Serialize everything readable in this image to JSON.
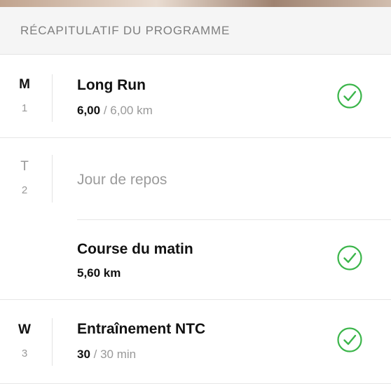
{
  "header": {
    "title": "RÉCAPITULATIF DU PROGRAMME"
  },
  "accent_color": "#3bb54a",
  "days": [
    {
      "letter": "M",
      "number": "1",
      "activities": [
        {
          "title": "Long Run",
          "done": "6,00",
          "separator": " / ",
          "goal": "6,00 km",
          "completed": true,
          "icon": "check-circle-icon"
        }
      ]
    },
    {
      "letter": "T",
      "number": "2",
      "rest_label": "Jour de repos",
      "activities": [
        {
          "title": "Course du matin",
          "done": "5,60 km",
          "completed": true,
          "icon": "check-circle-icon"
        }
      ]
    },
    {
      "letter": "W",
      "number": "3",
      "activities": [
        {
          "title": "Entraînement NTC",
          "done": "30",
          "separator": " / ",
          "goal": "30 min",
          "completed": true,
          "icon": "check-circle-icon"
        }
      ]
    }
  ]
}
